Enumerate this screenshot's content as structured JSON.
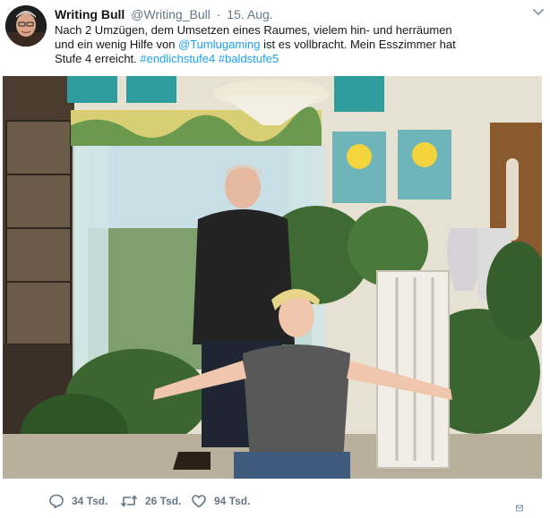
{
  "tweet": {
    "author": {
      "display_name": "Writing Bull",
      "handle": "@Writing_Bull"
    },
    "separator": "·",
    "date": "15. Aug.",
    "text": {
      "line1": "Nach 2 Umzügen, dem Umsetzen eines Raumes, vielem hin- und herräumen",
      "line2_start": "und ein wenig Hilfe von ",
      "mention": "@Tumlugaming",
      "line2_end": " ist es vollbracht. Mein Esszimmer hat",
      "line3_start": "Stufe 4 erreicht. ",
      "hashtag1": "#endlichstufe4",
      "hashtag2": "#baldstufe5"
    }
  },
  "actions": {
    "reply": {
      "icon": "reply-icon",
      "count": "34 Tsd."
    },
    "retweet": {
      "icon": "retweet-icon",
      "count": "26 Tsd."
    },
    "like": {
      "icon": "heart-icon",
      "count": "94 Tsd."
    }
  },
  "colors": {
    "link": "#1da1f2",
    "secondary_text": "#657786",
    "primary_text": "#14171a"
  }
}
